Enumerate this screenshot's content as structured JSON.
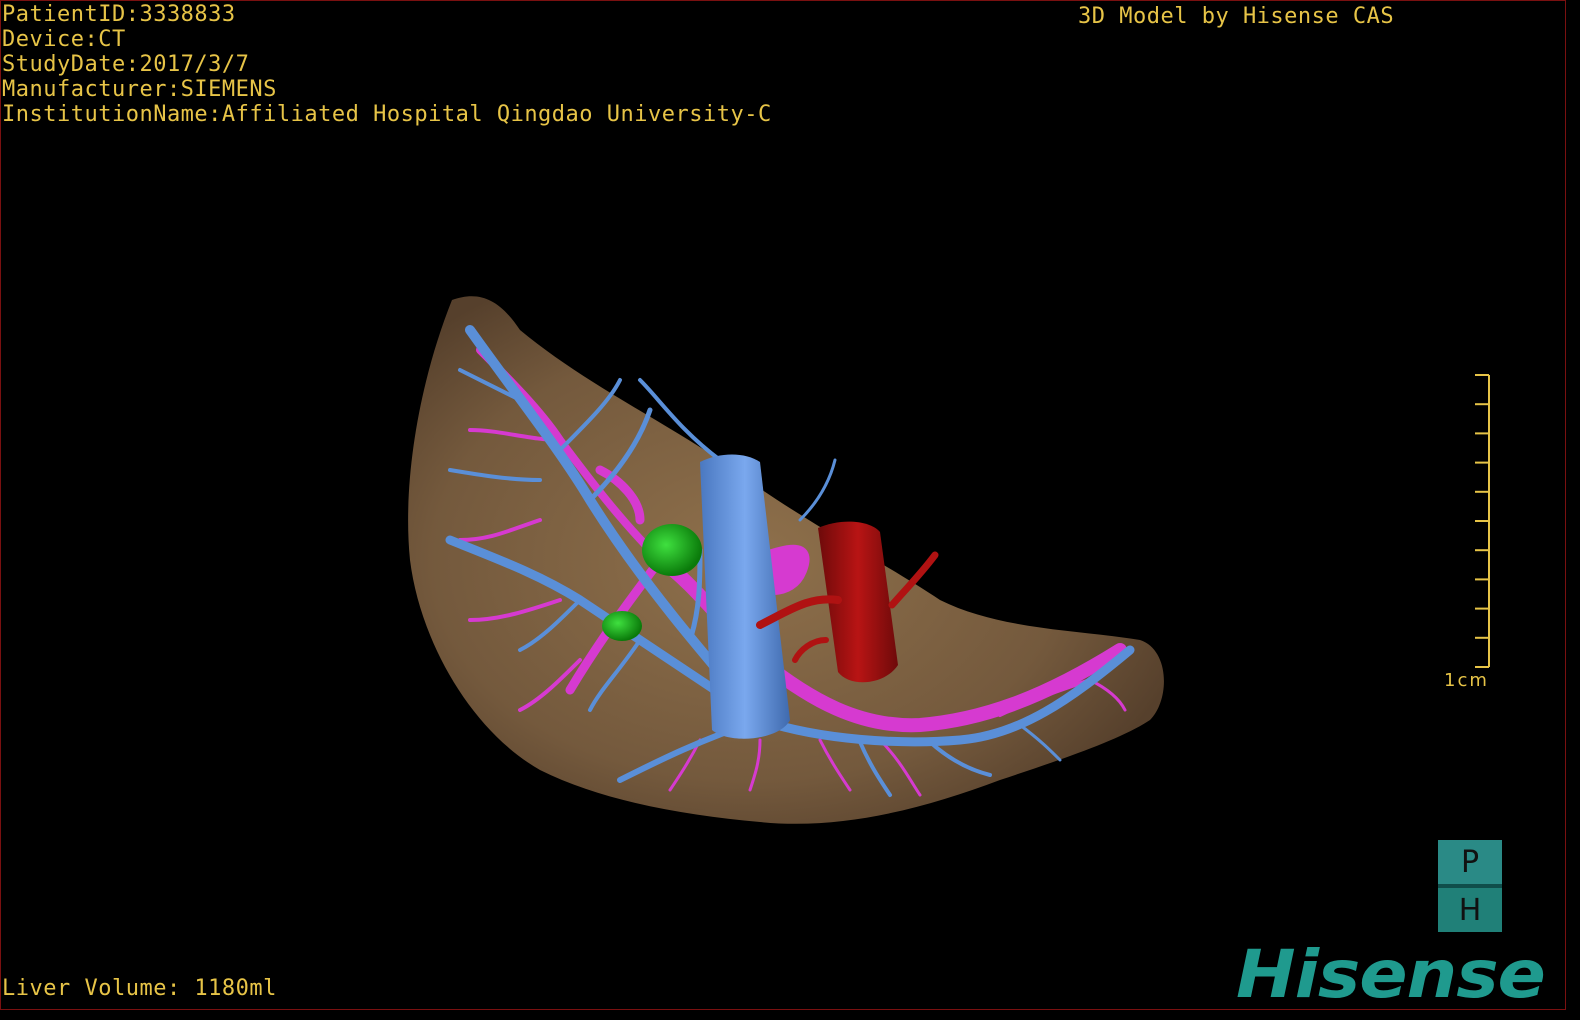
{
  "overlay": {
    "patient_id": "PatientID:3338833",
    "device": "Device:CT",
    "study_date": "StudyDate:2017/3/7",
    "manufacturer": "Manufacturer:SIEMENS",
    "institution": "InstitutionName:Affiliated Hospital Qingdao University-C",
    "credit": "3D Model by Hisense CAS",
    "liver_volume": "Liver Volume: 1180ml"
  },
  "scale": {
    "label": "1cm",
    "tick_count": 10
  },
  "orientation": {
    "top_label": "P",
    "bottom_label": "H"
  },
  "brand": {
    "name": "Hisense",
    "color": "#1f9a8e"
  },
  "model": {
    "structures": [
      {
        "name": "liver",
        "color": "#8a6a45"
      },
      {
        "name": "hepatic-vein",
        "color": "#5a8fd8"
      },
      {
        "name": "portal-vein",
        "color": "#d63ad0"
      },
      {
        "name": "lesion",
        "color": "#1fa51f"
      },
      {
        "name": "artery",
        "color": "#a01010"
      }
    ]
  },
  "colors": {
    "overlay_text": "#e7c447",
    "background": "#000000"
  }
}
